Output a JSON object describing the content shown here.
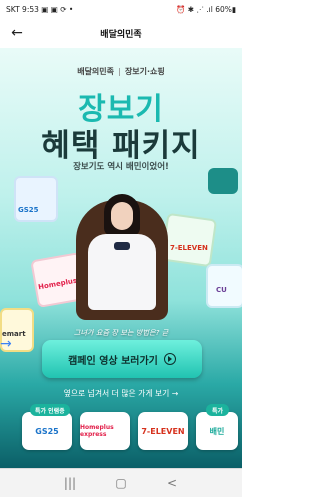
{
  "status": {
    "left": "SKT 9:53 ▣ ▣ ⟳ •",
    "right": "⏰ ✱ ⋰ .ıl 60%▮"
  },
  "appbar": {
    "title": "배달의민족",
    "back_icon": "back-arrow-icon"
  },
  "hero": {
    "brand": "배달의민족",
    "brand2": "장보기·쇼핑",
    "headline1": "장보기",
    "headline2": "혜택 패키지",
    "tagline": "장보기도 역시 배민이었어!",
    "bag_labels": {
      "gs25": "GS25",
      "homeplus": "Homeplus",
      "seven": "7-ELEVEN",
      "cu": "CU",
      "emart": "emart"
    },
    "caption": "그녀가 요즘 장 보는 방법은? 귿",
    "cta": {
      "label": "캠페인 영상 보러가기",
      "icon": "play-circle-icon"
    },
    "swipe": "옆으로 넘겨서 더 많은 가게 보기 →"
  },
  "cards": [
    {
      "badge": "특가 인램증",
      "label": "GS25",
      "color": "#1a73c9"
    },
    {
      "badge": "",
      "label": "Homeplus express",
      "color": "#e2214b"
    },
    {
      "badge": "",
      "label": "7-ELEVEN",
      "color": "#d6311d"
    },
    {
      "badge": "특가",
      "label": "배민",
      "color": "#18a999"
    }
  ],
  "navbar": {
    "recents": "|||",
    "home": "▢",
    "back": "<"
  }
}
